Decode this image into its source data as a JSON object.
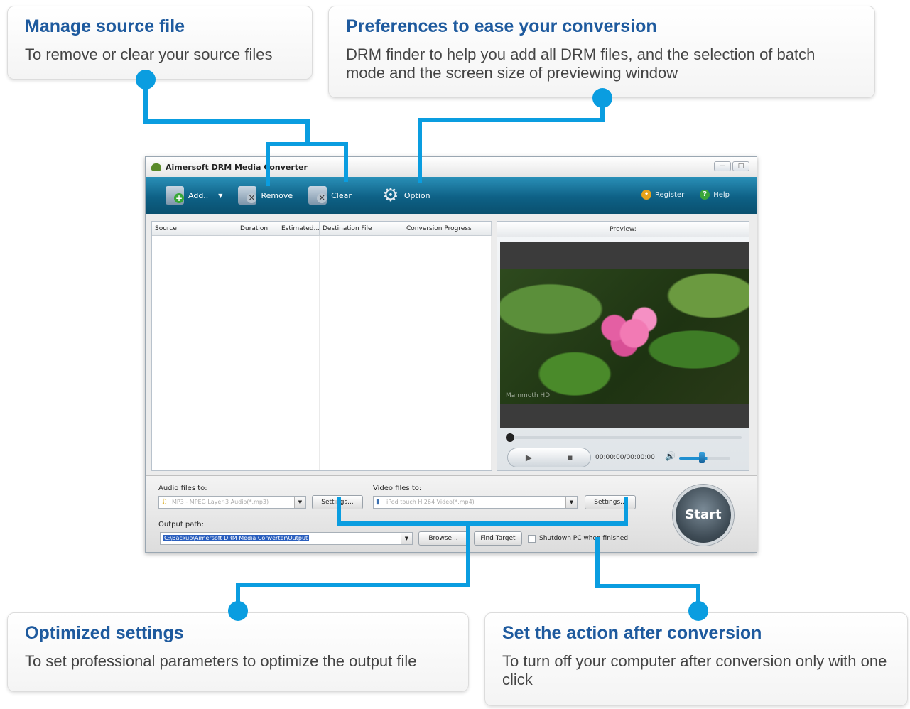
{
  "callouts": {
    "manage": {
      "title": "Manage source file",
      "desc": "To remove or clear your source files"
    },
    "preferences": {
      "title": "Preferences  to ease your conversion",
      "desc": "DRM finder to help you add  all DRM files, and the selection of batch mode  and the screen size of previewing window"
    },
    "optimized": {
      "title": "Optimized settings",
      "desc": "To set professional parameters to optimize the output file"
    },
    "action": {
      "title": "Set the action after conversion",
      "desc": "To turn off your computer after conversion only with one click"
    }
  },
  "colors": {
    "connector": "#0a9de0",
    "callout_title": "#1e5a9e",
    "toolbar": "#0e6186"
  },
  "app": {
    "title": "Aimersoft DRM Media Converter",
    "window_buttons": [
      "—",
      "□"
    ],
    "toolbar": {
      "add": "Add..",
      "remove": "Remove",
      "clear": "Clear",
      "option": "Option",
      "register": "Register",
      "help": "Help"
    },
    "file_list": {
      "columns": [
        "Source",
        "Duration",
        "Estimated...",
        "Destination File",
        "Conversion Progress"
      ]
    },
    "preview": {
      "header": "Preview:",
      "watermark": "Mammoth HD",
      "timecode": "00:00:00/00:00:00"
    },
    "bottom": {
      "audio_label": "Audio files to:",
      "audio_format": "MP3 - MPEG Layer-3 Audio(*.mp3)",
      "audio_settings": "Settings...",
      "video_label": "Video files to:",
      "video_format": "iPod touch H.264 Video(*.mp4)",
      "video_settings": "Settings...",
      "output_label": "Output path:",
      "output_path": "C:\\Backup\\Aimersoft DRM Media Converter\\Output",
      "browse": "Browse...",
      "find_target": "Find Target",
      "shutdown": "Shutdown PC when finished",
      "start": "Start"
    }
  }
}
